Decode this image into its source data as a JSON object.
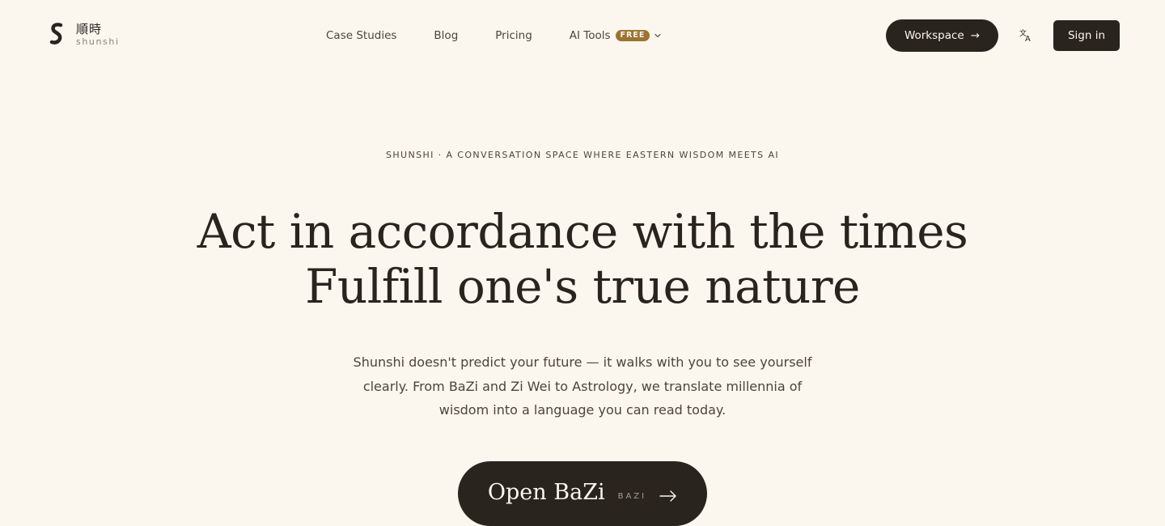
{
  "brand": {
    "name_cn": "順時",
    "name_en": "shunshi"
  },
  "nav": {
    "items": [
      {
        "label": "Case Studies"
      },
      {
        "label": "Blog"
      },
      {
        "label": "Pricing"
      },
      {
        "label": "AI Tools",
        "badge": "FREE"
      }
    ]
  },
  "header": {
    "workspace_label": "Workspace",
    "workspace_arrow": "→",
    "language_icon": "translate-icon",
    "signin_label": "Sign in"
  },
  "hero": {
    "eyebrow": "SHUNSHI · A CONVERSATION SPACE WHERE EASTERN WISDOM MEETS AI",
    "headline_line1": "Act in accordance with the times",
    "headline_line2": "Fulfill one's true nature",
    "subtext": "Shunshi doesn't predict your future — it walks with you to see yourself clearly. From BaZi and Zi Wei to Astrology, we translate millennia of wisdom into a language you can read today.",
    "cta_label": "Open BaZi",
    "cta_sub": "BAZI"
  },
  "colors": {
    "background": "#fbf6ee",
    "ink": "#2a241f",
    "badge": "#9b7432",
    "muted": "#8a8175"
  }
}
